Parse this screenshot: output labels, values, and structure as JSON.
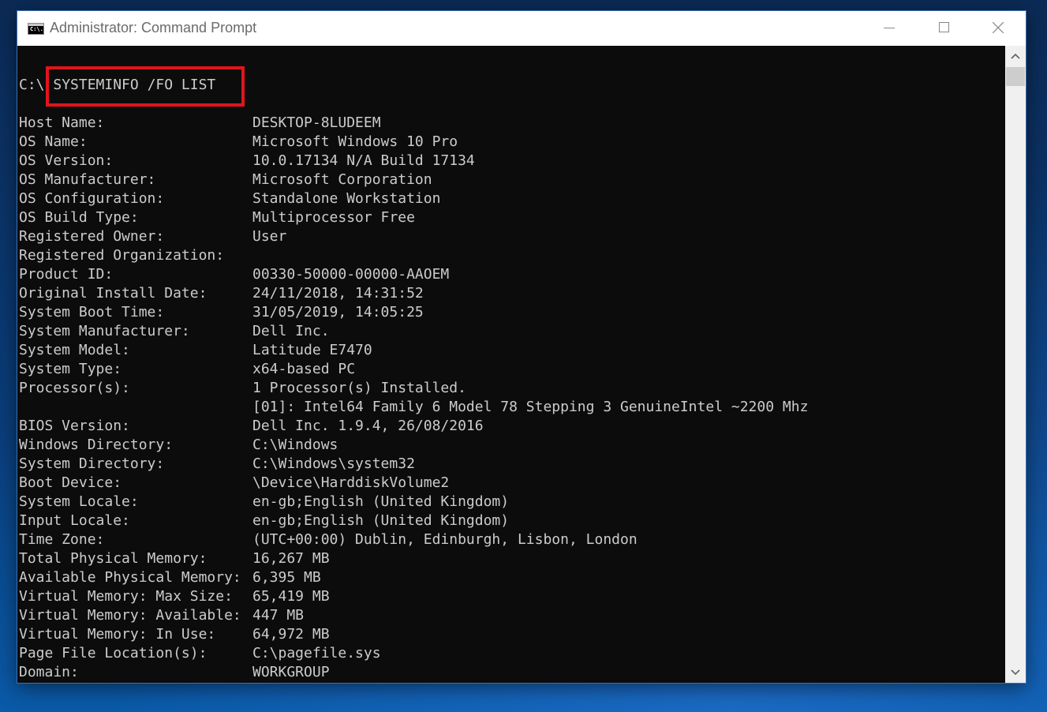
{
  "window": {
    "title": "Administrator: Command Prompt",
    "icon_text": "C:\\."
  },
  "prompt": {
    "path": "C:\\",
    "command": "SYSTEMINFO /FO LIST"
  },
  "highlight_color": "#e3141b",
  "output": [
    {
      "key": "Host Name:",
      "value": "DESKTOP-8LUDEEM"
    },
    {
      "key": "OS Name:",
      "value": "Microsoft Windows 10 Pro"
    },
    {
      "key": "OS Version:",
      "value": "10.0.17134 N/A Build 17134"
    },
    {
      "key": "OS Manufacturer:",
      "value": "Microsoft Corporation"
    },
    {
      "key": "OS Configuration:",
      "value": "Standalone Workstation"
    },
    {
      "key": "OS Build Type:",
      "value": "Multiprocessor Free"
    },
    {
      "key": "Registered Owner:",
      "value": "User"
    },
    {
      "key": "Registered Organization:",
      "value": ""
    },
    {
      "key": "Product ID:",
      "value": "00330-50000-00000-AAOEM"
    },
    {
      "key": "Original Install Date:",
      "value": "24/11/2018, 14:31:52"
    },
    {
      "key": "System Boot Time:",
      "value": "31/05/2019, 14:05:25"
    },
    {
      "key": "System Manufacturer:",
      "value": "Dell Inc."
    },
    {
      "key": "System Model:",
      "value": "Latitude E7470"
    },
    {
      "key": "System Type:",
      "value": "x64-based PC"
    },
    {
      "key": "Processor(s):",
      "value": "1 Processor(s) Installed."
    },
    {
      "key": "",
      "value": "[01]: Intel64 Family 6 Model 78 Stepping 3 GenuineIntel ~2200 Mhz"
    },
    {
      "key": "BIOS Version:",
      "value": "Dell Inc. 1.9.4, 26/08/2016"
    },
    {
      "key": "Windows Directory:",
      "value": "C:\\Windows"
    },
    {
      "key": "System Directory:",
      "value": "C:\\Windows\\system32"
    },
    {
      "key": "Boot Device:",
      "value": "\\Device\\HarddiskVolume2"
    },
    {
      "key": "System Locale:",
      "value": "en-gb;English (United Kingdom)"
    },
    {
      "key": "Input Locale:",
      "value": "en-gb;English (United Kingdom)"
    },
    {
      "key": "Time Zone:",
      "value": "(UTC+00:00) Dublin, Edinburgh, Lisbon, London"
    },
    {
      "key": "Total Physical Memory:",
      "value": "16,267 MB"
    },
    {
      "key": "Available Physical Memory:",
      "value": "6,395 MB"
    },
    {
      "key": "Virtual Memory: Max Size:",
      "value": "65,419 MB"
    },
    {
      "key": "Virtual Memory: Available:",
      "value": "447 MB"
    },
    {
      "key": "Virtual Memory: In Use:",
      "value": "64,972 MB"
    },
    {
      "key": "Page File Location(s):",
      "value": "C:\\pagefile.sys"
    },
    {
      "key": "Domain:",
      "value": "WORKGROUP"
    }
  ]
}
